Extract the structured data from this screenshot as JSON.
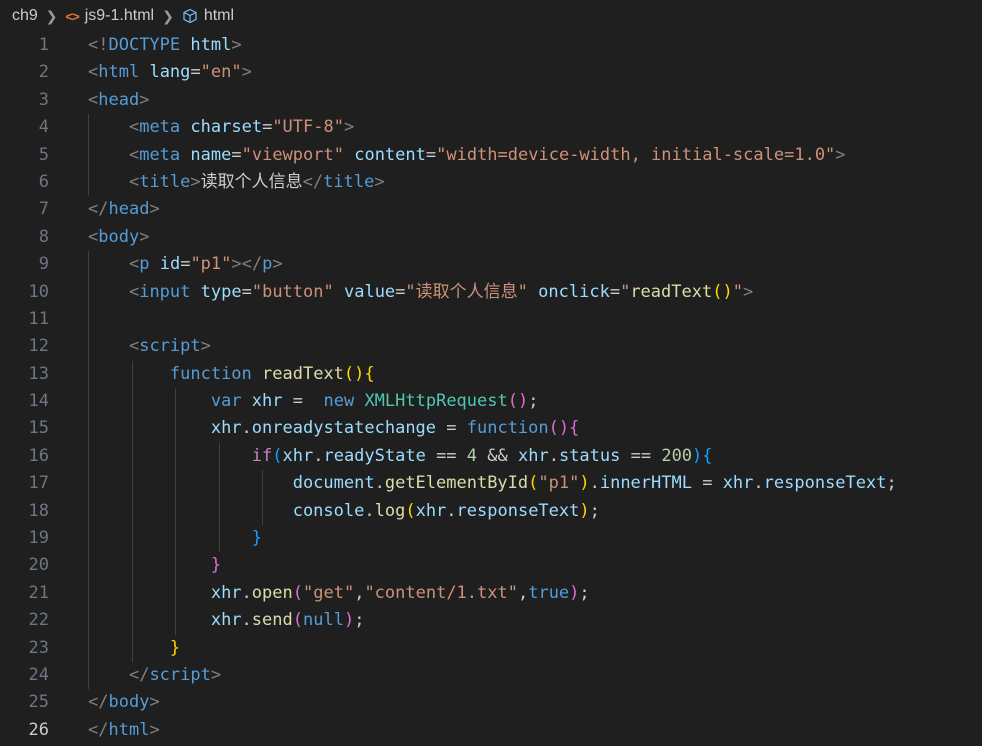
{
  "breadcrumb": {
    "folder": "ch9",
    "file": "js9-1.html",
    "symbol": "html",
    "file_icon": "html-file-icon",
    "symbol_icon": "cube-icon"
  },
  "editor": {
    "active_line": 26,
    "line_numbers": [
      "1",
      "2",
      "3",
      "4",
      "5",
      "6",
      "7",
      "8",
      "9",
      "10",
      "11",
      "12",
      "13",
      "14",
      "15",
      "16",
      "17",
      "18",
      "19",
      "20",
      "21",
      "22",
      "23",
      "24",
      "25",
      "26"
    ],
    "lines": [
      [
        [
          "p",
          "<!"
        ],
        [
          "tag",
          "DOCTYPE"
        ],
        [
          "txt",
          " "
        ],
        [
          "attr",
          "html"
        ],
        [
          "p",
          ">"
        ]
      ],
      [
        [
          "p",
          "<"
        ],
        [
          "tag",
          "html"
        ],
        [
          "txt",
          " "
        ],
        [
          "attr",
          "lang"
        ],
        [
          "eq",
          "="
        ],
        [
          "str",
          "\"en\""
        ],
        [
          "p",
          ">"
        ]
      ],
      [
        [
          "p",
          "<"
        ],
        [
          "tag",
          "head"
        ],
        [
          "p",
          ">"
        ]
      ],
      [
        [
          "txt",
          "    "
        ],
        [
          "p",
          "<"
        ],
        [
          "tag",
          "meta"
        ],
        [
          "txt",
          " "
        ],
        [
          "attr",
          "charset"
        ],
        [
          "eq",
          "="
        ],
        [
          "str",
          "\"UTF-8\""
        ],
        [
          "p",
          ">"
        ]
      ],
      [
        [
          "txt",
          "    "
        ],
        [
          "p",
          "<"
        ],
        [
          "tag",
          "meta"
        ],
        [
          "txt",
          " "
        ],
        [
          "attr",
          "name"
        ],
        [
          "eq",
          "="
        ],
        [
          "str",
          "\"viewport\""
        ],
        [
          "txt",
          " "
        ],
        [
          "attr",
          "content"
        ],
        [
          "eq",
          "="
        ],
        [
          "str",
          "\"width=device-width, initial-scale=1.0\""
        ],
        [
          "p",
          ">"
        ]
      ],
      [
        [
          "txt",
          "    "
        ],
        [
          "p",
          "<"
        ],
        [
          "tag",
          "title"
        ],
        [
          "p",
          ">"
        ],
        [
          "txt",
          "读取个人信息"
        ],
        [
          "p",
          "</"
        ],
        [
          "tag",
          "title"
        ],
        [
          "p",
          ">"
        ]
      ],
      [
        [
          "p",
          "</"
        ],
        [
          "tag",
          "head"
        ],
        [
          "p",
          ">"
        ]
      ],
      [
        [
          "p",
          "<"
        ],
        [
          "tag",
          "body"
        ],
        [
          "p",
          ">"
        ]
      ],
      [
        [
          "txt",
          "    "
        ],
        [
          "p",
          "<"
        ],
        [
          "tag",
          "p"
        ],
        [
          "txt",
          " "
        ],
        [
          "attr",
          "id"
        ],
        [
          "eq",
          "="
        ],
        [
          "str",
          "\"p1\""
        ],
        [
          "p",
          "></"
        ],
        [
          "tag",
          "p"
        ],
        [
          "p",
          ">"
        ]
      ],
      [
        [
          "txt",
          "    "
        ],
        [
          "p",
          "<"
        ],
        [
          "tag",
          "input"
        ],
        [
          "txt",
          " "
        ],
        [
          "attr",
          "type"
        ],
        [
          "eq",
          "="
        ],
        [
          "str",
          "\"button\""
        ],
        [
          "txt",
          " "
        ],
        [
          "attr",
          "value"
        ],
        [
          "eq",
          "="
        ],
        [
          "str",
          "\"读取个人信息\""
        ],
        [
          "txt",
          " "
        ],
        [
          "attr",
          "onclick"
        ],
        [
          "eq",
          "="
        ],
        [
          "str",
          "\""
        ],
        [
          "fn",
          "readText"
        ],
        [
          "b1",
          "()"
        ],
        [
          "str",
          "\""
        ],
        [
          "p",
          ">"
        ]
      ],
      [],
      [
        [
          "txt",
          "    "
        ],
        [
          "p",
          "<"
        ],
        [
          "tag",
          "script"
        ],
        [
          "p",
          ">"
        ]
      ],
      [
        [
          "txt",
          "        "
        ],
        [
          "kw",
          "function"
        ],
        [
          "txt",
          " "
        ],
        [
          "fn",
          "readText"
        ],
        [
          "b1",
          "(){"
        ]
      ],
      [
        [
          "txt",
          "            "
        ],
        [
          "kw",
          "var"
        ],
        [
          "txt",
          " "
        ],
        [
          "var",
          "xhr"
        ],
        [
          "txt",
          " =  "
        ],
        [
          "kw",
          "new"
        ],
        [
          "txt",
          " "
        ],
        [
          "cls",
          "XMLHttpRequest"
        ],
        [
          "b2",
          "()"
        ],
        [
          "txt",
          ";"
        ]
      ],
      [
        [
          "txt",
          "            "
        ],
        [
          "var",
          "xhr"
        ],
        [
          "txt",
          "."
        ],
        [
          "var",
          "onreadystatechange"
        ],
        [
          "txt",
          " = "
        ],
        [
          "kw",
          "function"
        ],
        [
          "b2",
          "(){"
        ]
      ],
      [
        [
          "txt",
          "                "
        ],
        [
          "ctl",
          "if"
        ],
        [
          "b3",
          "("
        ],
        [
          "var",
          "xhr"
        ],
        [
          "txt",
          "."
        ],
        [
          "var",
          "readyState"
        ],
        [
          "txt",
          " == "
        ],
        [
          "num",
          "4"
        ],
        [
          "txt",
          " && "
        ],
        [
          "var",
          "xhr"
        ],
        [
          "txt",
          "."
        ],
        [
          "var",
          "status"
        ],
        [
          "txt",
          " == "
        ],
        [
          "num",
          "200"
        ],
        [
          "b3",
          "){"
        ]
      ],
      [
        [
          "txt",
          "                    "
        ],
        [
          "var",
          "document"
        ],
        [
          "txt",
          "."
        ],
        [
          "fn",
          "getElementById"
        ],
        [
          "b1",
          "("
        ],
        [
          "str",
          "\"p1\""
        ],
        [
          "b1",
          ")"
        ],
        [
          "txt",
          "."
        ],
        [
          "var",
          "innerHTML"
        ],
        [
          "txt",
          " = "
        ],
        [
          "var",
          "xhr"
        ],
        [
          "txt",
          "."
        ],
        [
          "var",
          "responseText"
        ],
        [
          "txt",
          ";"
        ]
      ],
      [
        [
          "txt",
          "                    "
        ],
        [
          "var",
          "console"
        ],
        [
          "txt",
          "."
        ],
        [
          "fn",
          "log"
        ],
        [
          "b1",
          "("
        ],
        [
          "var",
          "xhr"
        ],
        [
          "txt",
          "."
        ],
        [
          "var",
          "responseText"
        ],
        [
          "b1",
          ")"
        ],
        [
          "txt",
          ";"
        ]
      ],
      [
        [
          "txt",
          "                "
        ],
        [
          "b3",
          "}"
        ]
      ],
      [
        [
          "txt",
          "            "
        ],
        [
          "b2",
          "}"
        ]
      ],
      [
        [
          "txt",
          "            "
        ],
        [
          "var",
          "xhr"
        ],
        [
          "txt",
          "."
        ],
        [
          "fn",
          "open"
        ],
        [
          "b2",
          "("
        ],
        [
          "str",
          "\"get\""
        ],
        [
          "txt",
          ","
        ],
        [
          "str",
          "\"content/1.txt\""
        ],
        [
          "txt",
          ","
        ],
        [
          "kw",
          "true"
        ],
        [
          "b2",
          ")"
        ],
        [
          "txt",
          ";"
        ]
      ],
      [
        [
          "txt",
          "            "
        ],
        [
          "var",
          "xhr"
        ],
        [
          "txt",
          "."
        ],
        [
          "fn",
          "send"
        ],
        [
          "b2",
          "("
        ],
        [
          "kw",
          "null"
        ],
        [
          "b2",
          ")"
        ],
        [
          "txt",
          ";"
        ]
      ],
      [
        [
          "txt",
          "        "
        ],
        [
          "b1",
          "}"
        ]
      ],
      [
        [
          "txt",
          "    "
        ],
        [
          "p",
          "</"
        ],
        [
          "tag",
          "script"
        ],
        [
          "p",
          ">"
        ]
      ],
      [
        [
          "p",
          "</"
        ],
        [
          "tag",
          "body"
        ],
        [
          "p",
          ">"
        ]
      ],
      [
        [
          "p",
          "</"
        ],
        [
          "tag",
          "html"
        ],
        [
          "p",
          ">"
        ]
      ]
    ]
  }
}
